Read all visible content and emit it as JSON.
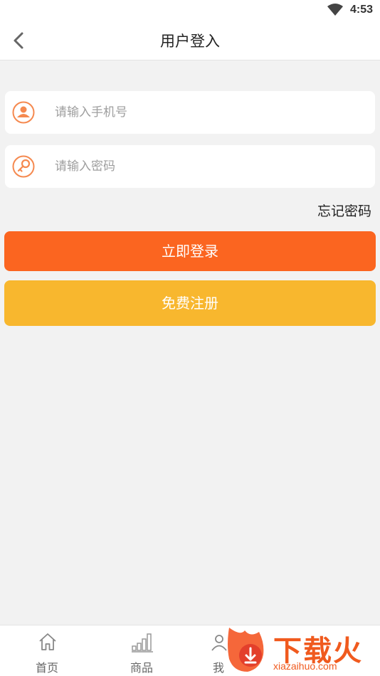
{
  "status_bar": {
    "time": "4:53",
    "wifi_icon": "wifi-icon"
  },
  "header": {
    "title": "用户登入",
    "back_icon": "chevron-left-icon"
  },
  "form": {
    "phone": {
      "placeholder": "请输入手机号",
      "value": "",
      "icon": "user-icon"
    },
    "password": {
      "placeholder": "请输入密码",
      "value": "",
      "icon": "key-icon"
    },
    "forgot_label": "忘记密码",
    "login_label": "立即登录",
    "register_label": "免费注册"
  },
  "tabs": [
    {
      "label": "首页",
      "icon": "home-icon"
    },
    {
      "label": "商品",
      "icon": "bar-chart-icon"
    },
    {
      "label": "我",
      "icon": "profile-icon"
    }
  ],
  "watermark": {
    "brand": "下载火",
    "url": "xiazaihuo.com"
  },
  "colors": {
    "accent_orange": "#fb6520",
    "register_yellow": "#f8b72e",
    "icon_orange": "#f5894f",
    "background": "#f2f2f2"
  }
}
